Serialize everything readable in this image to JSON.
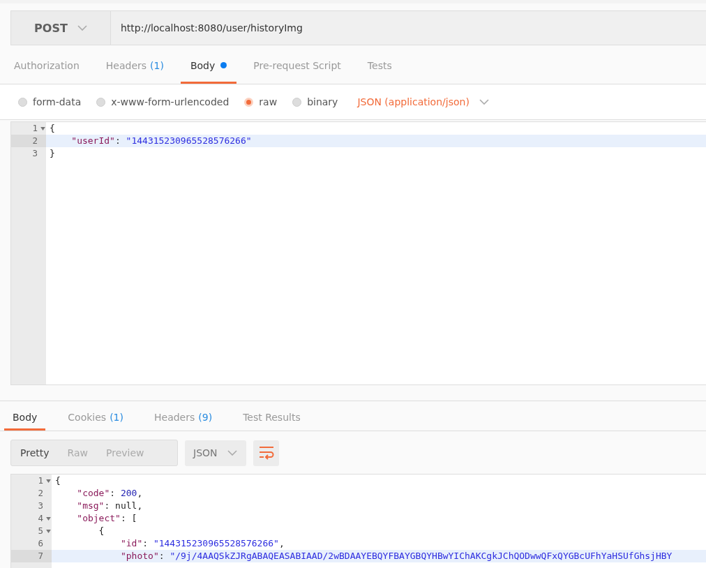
{
  "request": {
    "method": "POST",
    "url": "http://localhost:8080/user/historyImg",
    "tabs": [
      {
        "label": "Authorization",
        "selected": false
      },
      {
        "label": "Headers",
        "count": "(1)",
        "selected": false
      },
      {
        "label": "Body",
        "selected": true,
        "dot": true
      },
      {
        "label": "Pre-request Script",
        "selected": false
      },
      {
        "label": "Tests",
        "selected": false
      }
    ],
    "body_modes": [
      {
        "label": "form-data",
        "selected": false
      },
      {
        "label": "x-www-form-urlencoded",
        "selected": false
      },
      {
        "label": "raw",
        "selected": true
      },
      {
        "label": "binary",
        "selected": false
      }
    ],
    "content_type": "JSON (application/json)",
    "editor": [
      {
        "number": "1",
        "foldable": true,
        "selected": false,
        "tokens": [
          {
            "kind": "punct",
            "text": "{"
          }
        ]
      },
      {
        "number": "2",
        "foldable": false,
        "selected": true,
        "tokens": [
          {
            "kind": "key",
            "text": "    \"userId\""
          },
          {
            "kind": "punct",
            "text": ": "
          },
          {
            "kind": "string",
            "text": "\"144315230965528576266\""
          }
        ]
      },
      {
        "number": "3",
        "foldable": false,
        "selected": false,
        "tokens": [
          {
            "kind": "punct",
            "text": "}"
          }
        ]
      }
    ]
  },
  "response": {
    "tabs": [
      {
        "label": "Body",
        "selected": true
      },
      {
        "label": "Cookies",
        "count": "(1)",
        "selected": false
      },
      {
        "label": "Headers",
        "count": "(9)",
        "selected": false
      },
      {
        "label": "Test Results",
        "selected": false
      }
    ],
    "views": [
      {
        "label": "Pretty",
        "selected": true
      },
      {
        "label": "Raw",
        "selected": false
      },
      {
        "label": "Preview",
        "selected": false
      }
    ],
    "format": "JSON",
    "editor": [
      {
        "number": "1",
        "foldable": true,
        "selected": false,
        "tokens": [
          {
            "kind": "punct",
            "text": "{"
          }
        ]
      },
      {
        "number": "2",
        "foldable": false,
        "selected": false,
        "tokens": [
          {
            "kind": "key",
            "text": "    \"code\""
          },
          {
            "kind": "punct",
            "text": ": "
          },
          {
            "kind": "number",
            "text": "200"
          },
          {
            "kind": "punct",
            "text": ","
          }
        ]
      },
      {
        "number": "3",
        "foldable": false,
        "selected": false,
        "tokens": [
          {
            "kind": "key",
            "text": "    \"msg\""
          },
          {
            "kind": "punct",
            "text": ": null,"
          }
        ]
      },
      {
        "number": "4",
        "foldable": true,
        "selected": false,
        "tokens": [
          {
            "kind": "key",
            "text": "    \"object\""
          },
          {
            "kind": "punct",
            "text": ": ["
          }
        ]
      },
      {
        "number": "5",
        "foldable": true,
        "selected": false,
        "tokens": [
          {
            "kind": "punct",
            "text": "        {"
          }
        ]
      },
      {
        "number": "6",
        "foldable": false,
        "selected": false,
        "tokens": [
          {
            "kind": "key",
            "text": "            \"id\""
          },
          {
            "kind": "punct",
            "text": ": "
          },
          {
            "kind": "string",
            "text": "\"144315230965528576266\""
          },
          {
            "kind": "punct",
            "text": ","
          }
        ]
      },
      {
        "number": "7",
        "foldable": false,
        "selected": true,
        "tokens": [
          {
            "kind": "key",
            "text": "            \"photo\""
          },
          {
            "kind": "punct",
            "text": ": "
          },
          {
            "kind": "string",
            "text": "\"/9j/4AAQSkZJRgABAQEASABIAAD/2wBDAAYEBQYFBAYGBQYHBwYIChAKCgkJChQODwwQFxQYGBcUFhYaHSUfGhsjHBY"
          }
        ]
      }
    ]
  }
}
